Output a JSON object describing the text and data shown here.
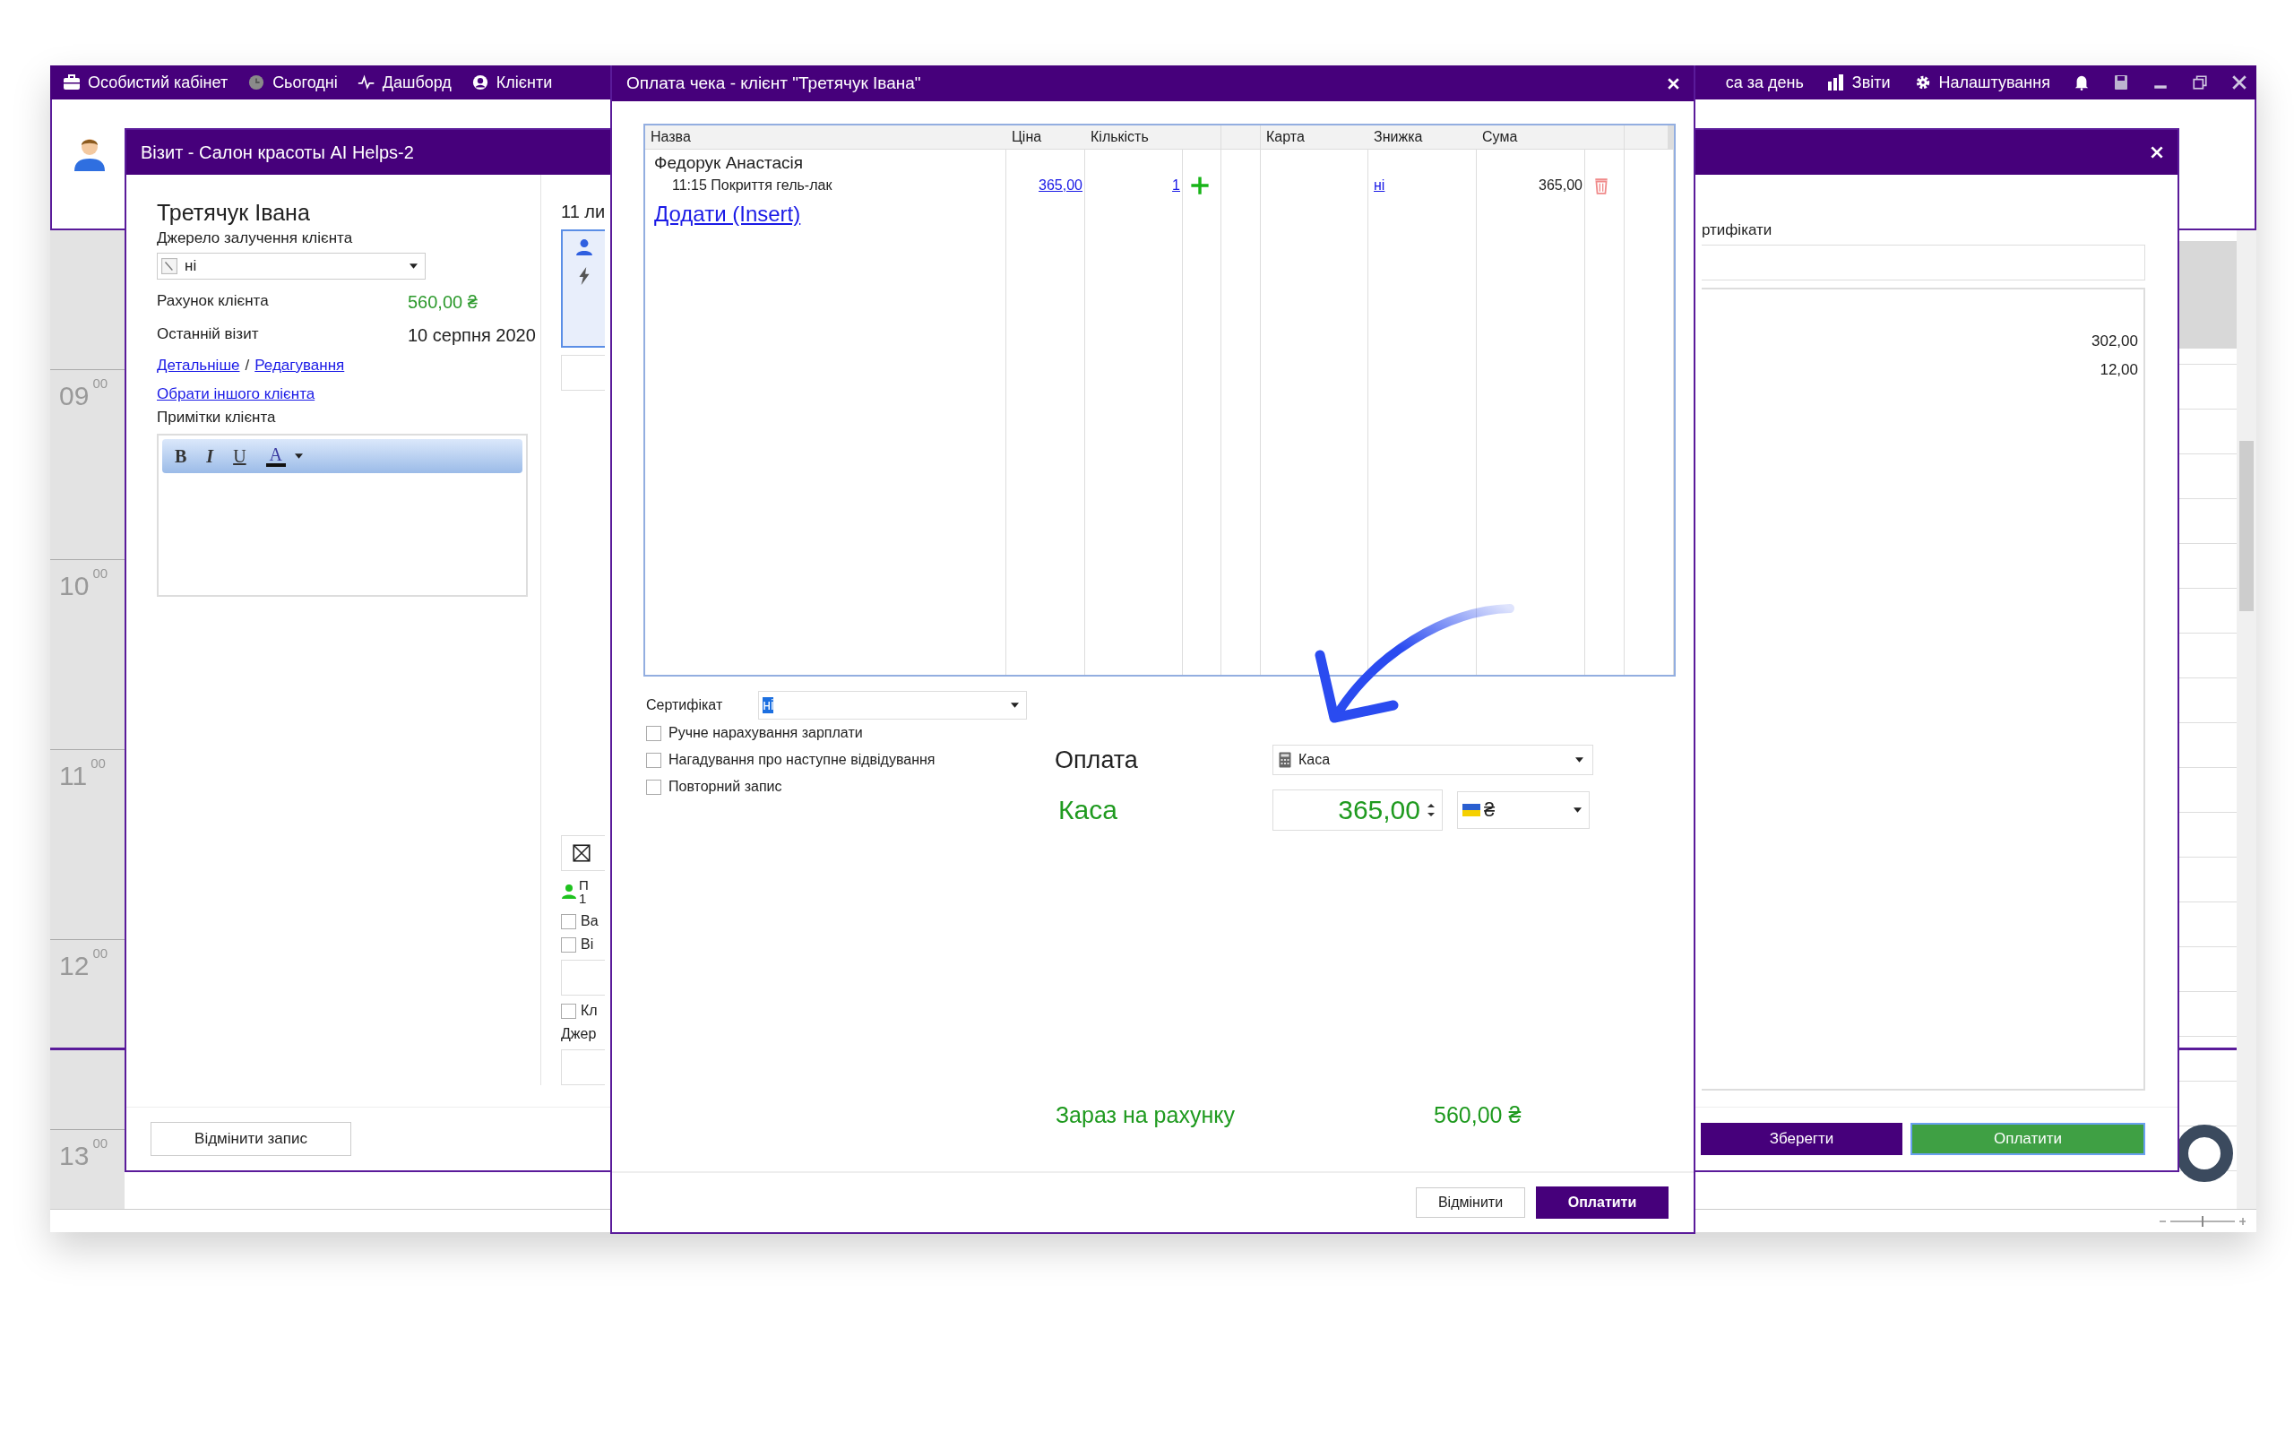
{
  "top_bar": {
    "left_items": [
      {
        "kind": "cabinet",
        "label": "Особистий кабінет"
      },
      {
        "kind": "today",
        "label": "Сьогодні"
      },
      {
        "kind": "dashboard",
        "label": "Дашборд"
      },
      {
        "kind": "clients",
        "label": "Клієнти"
      }
    ],
    "right_items": [
      {
        "kind": "plain",
        "label": "са за день"
      },
      {
        "kind": "reports",
        "label": "Звіти"
      },
      {
        "kind": "settings",
        "label": "Налаштування"
      }
    ]
  },
  "zoom_slider": {
    "level": 0.5
  },
  "schedule": {
    "hours": [
      {
        "hour": "09",
        "minutes": "00"
      },
      {
        "hour": "10",
        "minutes": "00"
      },
      {
        "hour": "11",
        "minutes": "00"
      },
      {
        "hour": "12",
        "minutes": "00"
      },
      {
        "hour": "13",
        "minutes": "00"
      }
    ]
  },
  "visit_dialog": {
    "title": "Візит - Салон красоты AI Helps-2",
    "client_name": "Третячук Івана",
    "source_label": "Джерело залучення клієнта",
    "source_value": "ні",
    "info_rows": [
      {
        "label": "Рахунок клієнта",
        "value": "560,00 ₴",
        "kind": "money"
      },
      {
        "label": "Останній візит",
        "value": "10 серпня 2020",
        "kind": "plain"
      }
    ],
    "link_details": "Детальніше",
    "link_separator": "/",
    "link_edit": "Редагування",
    "link_other_client": "Обрати іншого клієнта",
    "notes_label": "Примітки клієнта",
    "editor_tools": [
      {
        "kind": "bold",
        "label": "B"
      },
      {
        "kind": "italic",
        "label": "I"
      },
      {
        "kind": "underline",
        "label": "U"
      },
      {
        "kind": "color",
        "label": "A"
      }
    ],
    "cancel_button": "Відмінити запис",
    "middle": {
      "date": "11 ли",
      "client_letter": "П",
      "client_time": "1",
      "checkboxes": [
        {
          "label": "Ва",
          "checked": false
        },
        {
          "label": "Ві",
          "checked": false
        }
      ],
      "checkbox_last": {
        "label": "Кл",
        "checked": false
      },
      "source_label": "Джер"
    },
    "right": {
      "section_label": "ртифікати",
      "amounts": [
        "302,00",
        "12,00"
      ],
      "save_button": "Зберегти",
      "pay_button": "Оплатити"
    }
  },
  "payment_dialog": {
    "title": "Оплата чека - клієнт \"Третячук Івана\"",
    "table": {
      "columns": [
        "Назва",
        "Ціна",
        "Кількість",
        "Карта",
        "Знижка",
        "Сума"
      ],
      "group": "Федорук Анастасія",
      "rows": [
        {
          "name": "11:15 Покриття гель-лак",
          "price": "365,00",
          "quantity": "1",
          "discount": "ні",
          "sum": "365,00"
        }
      ],
      "add_link": "Додати (Insert)"
    },
    "certificate_label": "Сертифікат",
    "certificate_value": "ні",
    "options": [
      {
        "label": "Ручне нарахування зарплати",
        "checked": false
      },
      {
        "label": "Нагадування про наступне відвідування",
        "checked": false
      },
      {
        "label": "Повторний запис",
        "checked": false
      }
    ],
    "payment_label": "Оплата",
    "payment_method": "Каса",
    "cash_label": "Каса",
    "amount": "365,00",
    "currency": "₴",
    "balance_label": "Зараз на рахунку",
    "balance_value": "560,00 ₴",
    "cancel_button": "Відмінити",
    "pay_button": "Оплатити"
  }
}
